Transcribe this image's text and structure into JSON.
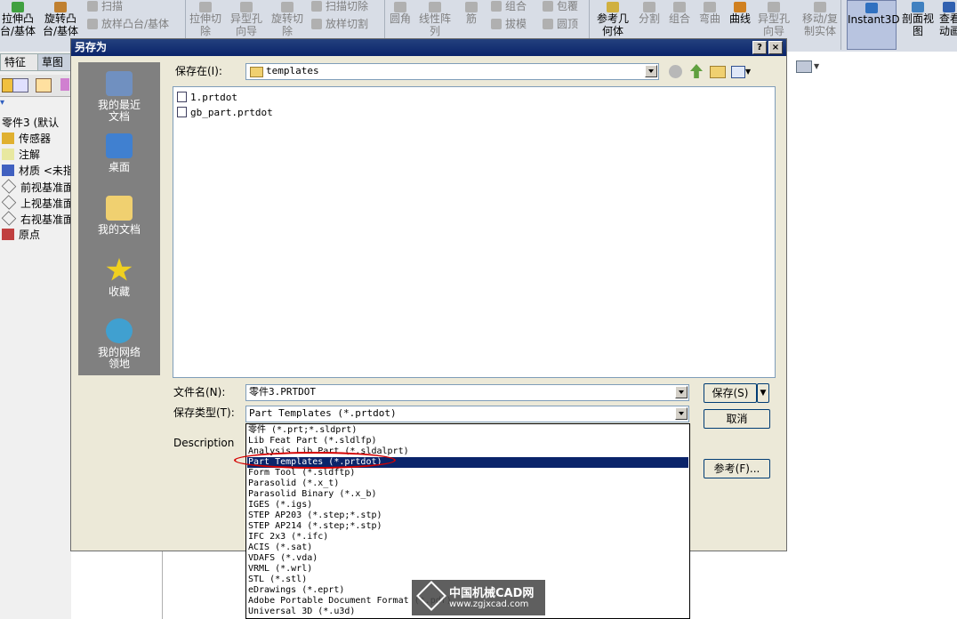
{
  "toolbar": {
    "items": [
      {
        "label": "拉伸凸\n台/基体",
        "gray": false
      },
      {
        "label": "旋转凸\n台/基体",
        "gray": false
      },
      {
        "label": "扫描",
        "gray": true
      },
      {
        "label": "放样凸台/基体",
        "gray": true
      },
      {
        "label": "拉伸切\n除",
        "gray": true
      },
      {
        "label": "异型孔\n向导",
        "gray": true
      },
      {
        "label": "旋转切\n除",
        "gray": true
      },
      {
        "label": "扫描切除",
        "gray": true
      },
      {
        "label": "放样切割",
        "gray": true
      },
      {
        "label": "圆角",
        "gray": true
      },
      {
        "label": "线性阵\n列",
        "gray": true
      },
      {
        "label": "筋",
        "gray": true
      },
      {
        "label": "组合",
        "gray": true
      },
      {
        "label": "拔模",
        "gray": true
      },
      {
        "label": "包覆",
        "gray": true
      },
      {
        "label": "圆顶",
        "gray": true
      },
      {
        "label": "参考几\n何体",
        "gray": false
      },
      {
        "label": "分割",
        "gray": true
      },
      {
        "label": "组合",
        "gray": true
      },
      {
        "label": "弯曲",
        "gray": true
      },
      {
        "label": "曲线",
        "gray": false
      },
      {
        "label": "异型孔\n向导",
        "gray": true
      },
      {
        "label": "移动/复\n制实体",
        "gray": true
      },
      {
        "label": "Instant3D",
        "gray": false
      },
      {
        "label": "剖面视\n图",
        "gray": false
      },
      {
        "label": "查看\n动画",
        "gray": false
      }
    ]
  },
  "left_panel": {
    "tabs": [
      "特征",
      "草图"
    ],
    "tree": [
      {
        "label": "零件3  (默认"
      },
      {
        "label": "传感器"
      },
      {
        "label": "注解"
      },
      {
        "label": "材质 <未指"
      },
      {
        "label": "前视基准面"
      },
      {
        "label": "上视基准面"
      },
      {
        "label": "右视基准面"
      },
      {
        "label": "原点"
      }
    ]
  },
  "dialog": {
    "title": "另存为",
    "help_btn": "?",
    "close_btn": "×",
    "save_in_label": "保存在(I):",
    "save_in_value": "templates",
    "places": [
      {
        "label": "我的最近\n文档",
        "icon": "recent-docs-icon"
      },
      {
        "label": "桌面",
        "icon": "desktop-icon"
      },
      {
        "label": "我的文档",
        "icon": "my-documents-icon"
      },
      {
        "label": "收藏",
        "icon": "favorites-icon"
      },
      {
        "label": "我的网络\n领地",
        "icon": "network-places-icon"
      }
    ],
    "files": [
      "1.prtdot",
      "gb_part.prtdot"
    ],
    "filename_label": "文件名(N):",
    "filename_value": "零件3.PRTDOT",
    "filetype_label": "保存类型(T):",
    "filetype_value": "Part Templates (*.prtdot)",
    "description_label": "Description",
    "save_btn": "保存(S)",
    "cancel_btn": "取消",
    "reference_btn": "参考(F)...",
    "filetype_options": [
      "零件 (*.prt;*.sldprt)",
      "Lib Feat Part (*.sldlfp)",
      "Analysis Lib Part (*.sldalprt)",
      "Part Templates (*.prtdot)",
      "Form Tool (*.sldftp)",
      "Parasolid (*.x_t)",
      "Parasolid Binary (*.x_b)",
      "IGES (*.igs)",
      "STEP AP203 (*.step;*.stp)",
      "STEP AP214 (*.step;*.stp)",
      "IFC 2x3 (*.ifc)",
      "ACIS (*.sat)",
      "VDAFS (*.vda)",
      "VRML (*.wrl)",
      "STL (*.stl)",
      "eDrawings (*.eprt)",
      "Adobe Portable Document Format (*.pdf)",
      "Universal 3D (*.u3d)"
    ],
    "selected_option_index": 3
  },
  "watermark": {
    "line1": "中国机械CAD网",
    "line2": "www.zgjxcad.com"
  },
  "colors": {
    "title_bar": "#0a246a",
    "selection": "#0a246a",
    "highlight_circle": "#d40000",
    "places_bar": "#808080"
  }
}
